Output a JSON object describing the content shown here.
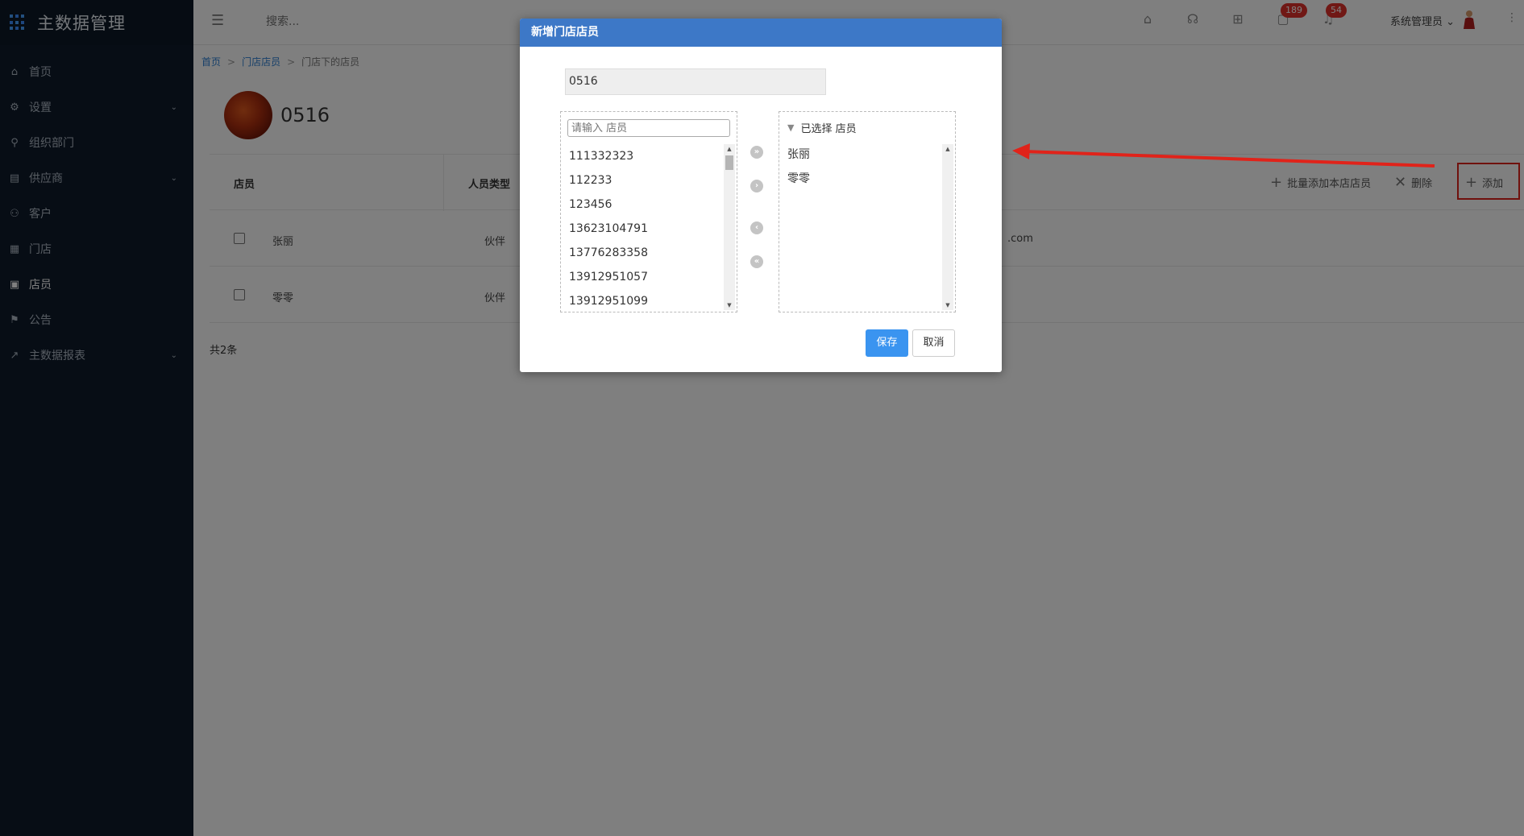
{
  "app": {
    "title": "主数据管理"
  },
  "sidebar": {
    "items": [
      {
        "label": "首页",
        "icon": "home-icon"
      },
      {
        "label": "设置",
        "icon": "gear-icon"
      },
      {
        "label": "组织部门",
        "icon": "org-icon"
      },
      {
        "label": "供应商",
        "icon": "supplier-icon"
      },
      {
        "label": "客户",
        "icon": "customer-icon"
      },
      {
        "label": "门店",
        "icon": "store-icon"
      },
      {
        "label": "店员",
        "icon": "clerk-icon"
      },
      {
        "label": "公告",
        "icon": "notice-icon"
      },
      {
        "label": "主数据报表",
        "icon": "chart-icon"
      }
    ]
  },
  "topbar": {
    "search_placeholder": "搜索...",
    "messages_badge": "189",
    "notifications_badge": "54",
    "user_name": "系统管理员"
  },
  "breadcrumb": {
    "home": "首页",
    "parent": "门店店员",
    "current": "门店下的店员"
  },
  "store": {
    "name": "0516"
  },
  "table": {
    "headers": {
      "clerk": "店员",
      "type": "人员类型"
    },
    "toolbar": {
      "batch_add": "批量添加本店店员",
      "delete": "删除",
      "add": "添加"
    },
    "rows": [
      {
        "name": "张丽",
        "type": "伙伴",
        "email": ".com"
      },
      {
        "name": "零零",
        "type": "伙伴",
        "email": ""
      }
    ],
    "total": "共2条"
  },
  "dialog": {
    "title": "新增门店店员",
    "store_value": "0516",
    "filter_placeholder": "请输入 店员",
    "available": [
      "111332323",
      "112233",
      "123456",
      "13623104791",
      "13776283358",
      "13912951057",
      "13912951099"
    ],
    "selected_group": "已选择 店员",
    "selected": [
      "张丽",
      "零零"
    ],
    "save_label": "保存",
    "cancel_label": "取消"
  },
  "colors": {
    "sidebar_bg": "#0e1b2b",
    "dialog_header": "#3d78c7",
    "save_button": "#3a94f0",
    "badge": "#e0312a",
    "highlight": "#e0231a"
  }
}
